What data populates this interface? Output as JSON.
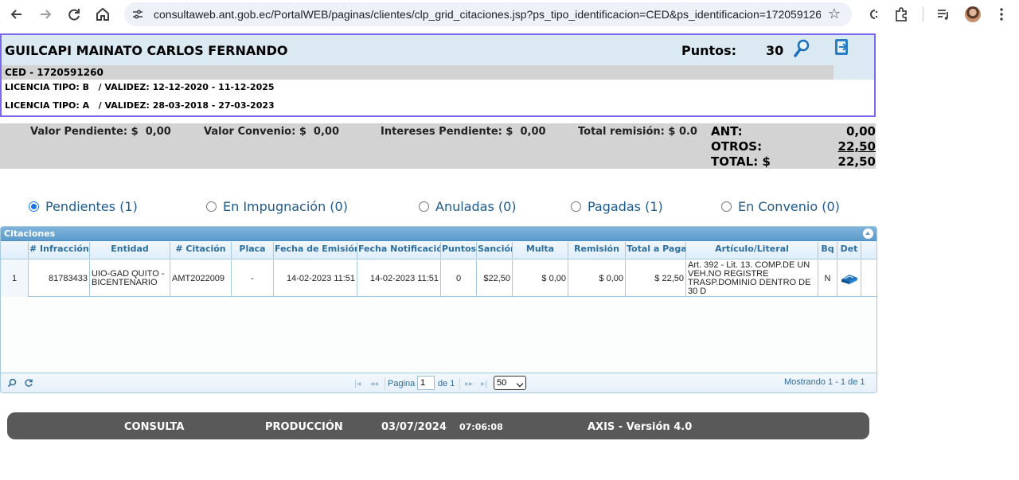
{
  "browser": {
    "url": "consultaweb.ant.gob.ec/PortalWEB/paginas/clientes/clp_grid_citaciones.jsp?ps_tipo_identificacion=CED&ps_identificacion=172059126...",
    "icons": [
      "back-arrow-icon",
      "forward-arrow-icon",
      "reload-icon",
      "home-icon",
      "site-settings-icon",
      "bookmark-star-icon",
      "extension-icon",
      "puzzle-icon",
      "media-control-icon",
      "profile-avatar",
      "menu-dots-icon"
    ]
  },
  "header": {
    "name": "GUILCAPI MAINATO CARLOS FERNANDO",
    "points_label": "Puntos:",
    "points_value": "30",
    "ced": "CED - 1720591260",
    "licenses": [
      "LICENCIA TIPO: B   / VALIDEZ: 12-12-2020 - 11-12-2025",
      "LICENCIA TIPO: A   / VALIDEZ: 28-03-2018 - 27-03-2023"
    ]
  },
  "summary": {
    "valor_pendiente": "Valor Pendiente: $  0,00",
    "valor_convenio": "Valor Convenio: $  0,00",
    "intereses_pendiente": "Intereses Pendiente: $  0,00",
    "total_remision": "Total remisión: $ 0.0",
    "ant_label": "ANT:",
    "ant_value": "0,00",
    "otros_label": "OTROS:",
    "otros_value": "22,50",
    "total_label": "TOTAL: $",
    "total_value": "22,50"
  },
  "filters": [
    {
      "label": "Pendientes (1)",
      "selected": true
    },
    {
      "label": "En Impugnación (0)",
      "selected": false
    },
    {
      "label": "Anuladas (0)",
      "selected": false
    },
    {
      "label": "Pagadas (1)",
      "selected": false
    },
    {
      "label": "En Convenio (0)",
      "selected": false
    }
  ],
  "grid": {
    "caption": "Citaciones",
    "columns": [
      "# Infracción",
      "Entidad",
      "# Citación",
      "Placa",
      "Fecha de Emisión",
      "Fecha Notificación",
      "Puntos",
      "Sanción",
      "Multa",
      "Remisión",
      "Total a Pagar",
      "Artículo/Literal",
      "Bq",
      "Det"
    ],
    "rows": [
      {
        "num": "1",
        "infraccion": "81783433",
        "entidad": "UIO-GAD QUITO - BICENTENARIO",
        "citacion": "AMT2022009",
        "placa": "-",
        "fecha_emision": "14-02-2023 11:51",
        "fecha_notificacion": "14-02-2023 11:51",
        "puntos": "0",
        "sancion": "$22,50",
        "multa": "$ 0,00",
        "remision": "$ 0,00",
        "total": "$ 22,50",
        "articulo": "Art. 392 - Lit. 13. COMP.DE UN VEH.NO REGISTRE TRASP.DOMINIO DENTRO DE 30 D",
        "bq": "N"
      }
    ],
    "pager": {
      "page_label": "Pagina",
      "page_value": "1",
      "of_label": "de 1",
      "rows_per_page": "50",
      "showing": "Mostrando 1 - 1 de 1"
    }
  },
  "footer": {
    "consulta": "CONSULTA",
    "produccion": "PRODUCCIÓN",
    "date": "03/07/2024",
    "time": "07:06:08",
    "version": "AXIS - Versión 4.0"
  },
  "colors": {
    "header_border": "#7b68ee",
    "header_bg": "#dbe9f2",
    "radio_text": "#1e5a8c",
    "grid_header": "#5c9ccc",
    "footer_bg": "#595959"
  }
}
